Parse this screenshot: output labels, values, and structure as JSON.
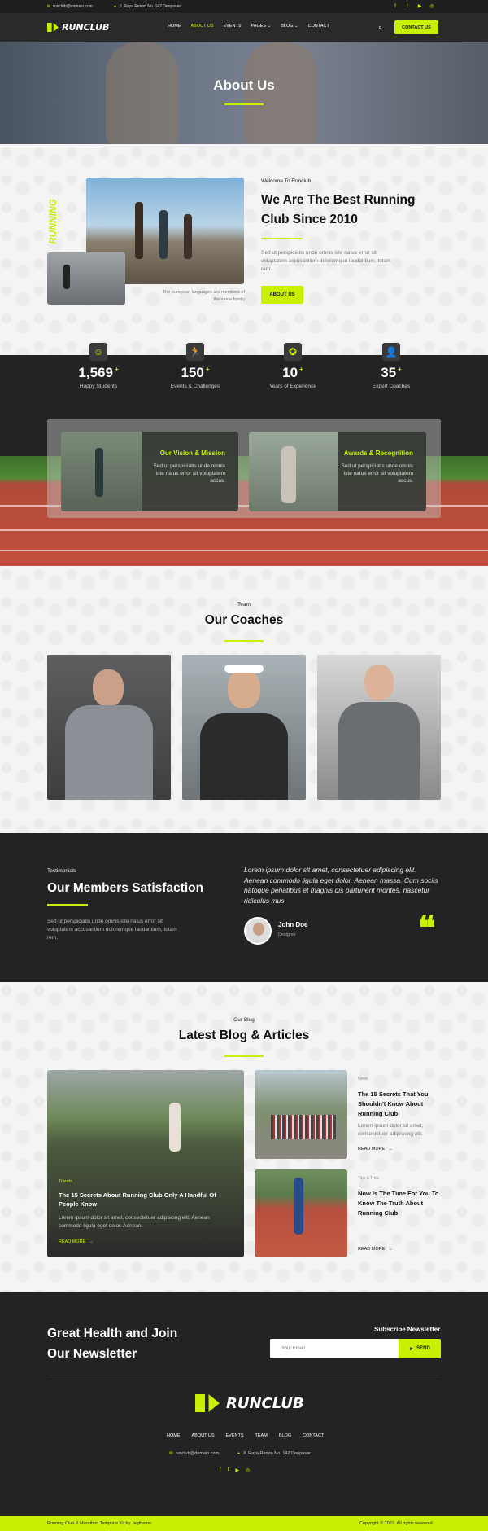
{
  "topbar": {
    "email": "runclub@domain.com",
    "address": "Jl. Raya Renon No. 142 Denpasar",
    "social": [
      "f",
      "t",
      "▶",
      "◎"
    ]
  },
  "brand": {
    "name": "RUNCLUB"
  },
  "nav": {
    "items": [
      "HOME",
      "ABOUT US",
      "EVENTS",
      "PAGES",
      "BLOG",
      "CONTACT"
    ],
    "active": "ABOUT US",
    "cta": "CONTACT US"
  },
  "hero": {
    "title": "About Us"
  },
  "about": {
    "eyebrow": "Welcome To Runclub",
    "title_line1": "We Are The Best Running",
    "title_line2": "Club Since 2010",
    "text": "Sed ut perspiciatis unde omnis iste natus error sit voluptatem accusantium doloremque laudantium, totam rem.",
    "caption": "The european languages are members of the same family",
    "button": "ABOUT US",
    "vertical_text": "RUNNING"
  },
  "stats": [
    {
      "value": "1,569",
      "plus": "+",
      "label": "Happy Students"
    },
    {
      "value": "150",
      "plus": "+",
      "label": "Events & Challenges"
    },
    {
      "value": "10",
      "plus": "+",
      "label": "Years of Experience"
    },
    {
      "value": "35",
      "plus": "+",
      "label": "Expert Coaches"
    }
  ],
  "cards": [
    {
      "title": "Our Vision & Mission",
      "text": "Sed ut perspiciatis unde omnis iste natus error sit voluptatem accus."
    },
    {
      "title": "Awards & Recognition",
      "text": "Sed ut perspiciatis unde omnis iste natus error sit voluptatem accus."
    }
  ],
  "coaches": {
    "eyebrow": "Team",
    "title": "Our Coaches"
  },
  "testimonial": {
    "eyebrow": "Testimonials",
    "title": "Our Members Satisfaction",
    "text": "Sed ut perspiciatis unde omnis iste natus error sit voluptatem accusantium doloremque laudantium, totam rem.",
    "quote": "Lorem ipsum dolor sit amet, consectetuer adipiscing elit. Aenean commodo ligula eget dolor. Aenean massa. Cum sociis natoque penatibus et magnis dis parturient montes, nascetur ridiculus mus.",
    "name": "John Doe",
    "role": "Designer"
  },
  "blog": {
    "eyebrow": "Our Blog",
    "title": "Latest Blog & Articles",
    "main": {
      "tag": "Trends",
      "title": "The 15 Secrets About Running Club Only A Handful Of People Know",
      "text": "Lorem ipsum dolor sit amet, consectetuer adipiscing elit. Aenean commodo ligula eget dolor. Aenean.",
      "more": "READ MORE"
    },
    "side": [
      {
        "tag": "News",
        "title": "The 15 Secrets That You Shouldn't Know About Running Club",
        "text": "Lorem ipsum dolor sit amet, consectetuer adipiscing elit.",
        "more": "READ MORE"
      },
      {
        "tag": "Tips & Trick",
        "title": "Now Is The Time For You To Know The Truth About Running Club",
        "text": "",
        "more": "READ MORE"
      }
    ]
  },
  "newsletter": {
    "title_line1": "Great Health and Join",
    "title_line2": "Our Newsletter",
    "label": "Subscribe Newsletter",
    "placeholder": "Your Email",
    "button": "SEND"
  },
  "footer": {
    "nav": [
      "HOME",
      "ABOUT US",
      "EVENTS",
      "TEAM",
      "BLOG",
      "CONTACT"
    ],
    "email": "runclub@domain.com",
    "address": "Jl. Raya Renon No. 142 Denpasar",
    "credit": "Running Club & Marathon Template Kit by Jegtheme",
    "copyright": "Copyright © 2022. All rights reserved."
  },
  "colors": {
    "accent": "#c8f000",
    "dark": "#232323"
  }
}
